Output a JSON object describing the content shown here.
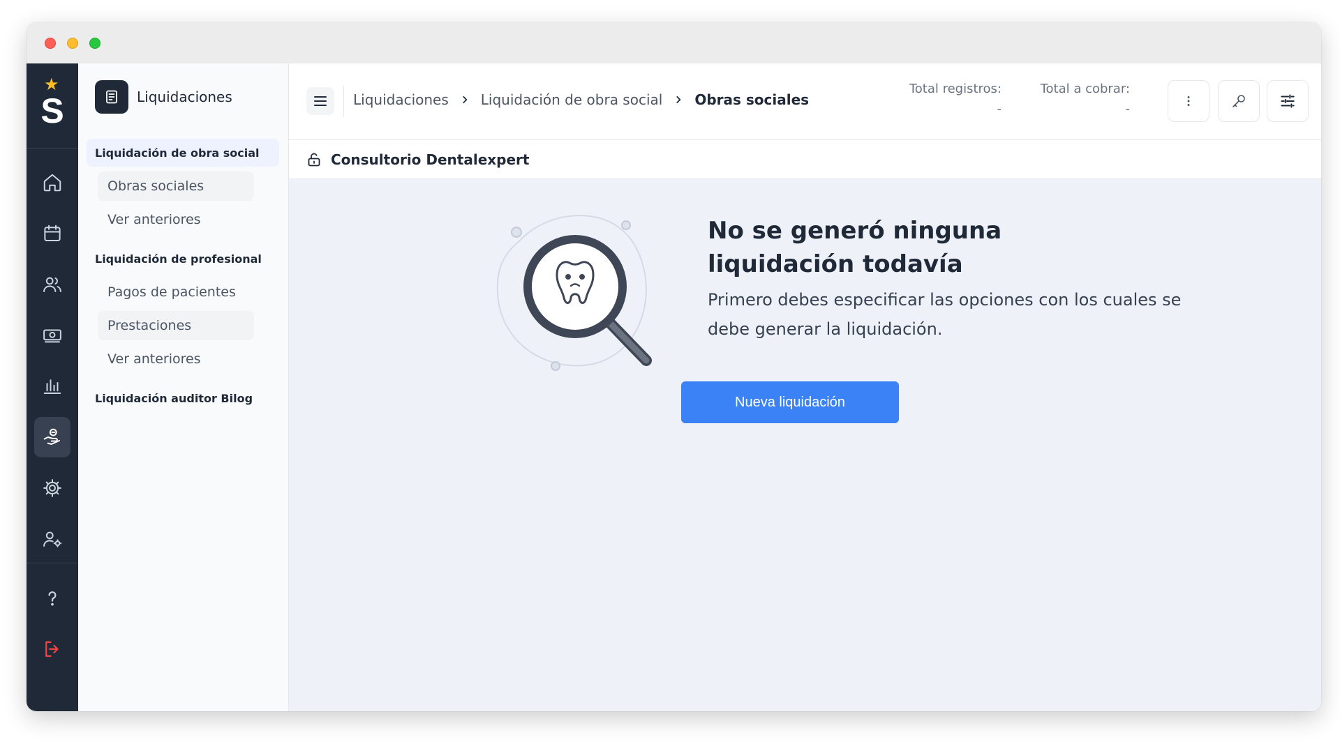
{
  "app": {
    "logo_letter": "S"
  },
  "subnav": {
    "title": "Liquidaciones",
    "sections": [
      {
        "label": "Liquidación de obra social",
        "items": [
          {
            "label": "Obras sociales"
          },
          {
            "label": "Ver anteriores"
          }
        ]
      },
      {
        "label": "Liquidación de profesional",
        "items": [
          {
            "label": "Pagos de pacientes"
          },
          {
            "label": "Prestaciones"
          },
          {
            "label": "Ver anteriores"
          }
        ]
      },
      {
        "label": "Liquidación auditor Bilog",
        "items": []
      }
    ]
  },
  "breadcrumb": [
    "Liquidaciones",
    "Liquidación de obra social",
    "Obras sociales"
  ],
  "stats": {
    "total_registros_label": "Total registros:",
    "total_registros_value": "-",
    "total_cobrar_label": "Total a cobrar:",
    "total_cobrar_value": "-"
  },
  "subbar": {
    "label": "Consultorio Dentalexpert"
  },
  "empty_state": {
    "title": "No se generó ninguna liquidación todavía",
    "description": "Primero debes especificar las opciones con los cuales se debe generar la liquidación.",
    "button_label": "Nueva liquidación"
  },
  "colors": {
    "rail": "#1f2937",
    "accent": "#3b82f6",
    "star": "#fbbf24",
    "logout": "#ef4444"
  },
  "icons": {
    "rail": [
      "home-icon",
      "calendar-icon",
      "users-icon",
      "money-icon",
      "chart-icon",
      "hand-coins-icon",
      "gear-icon",
      "user-settings-icon",
      "help-icon",
      "logout-icon"
    ]
  }
}
